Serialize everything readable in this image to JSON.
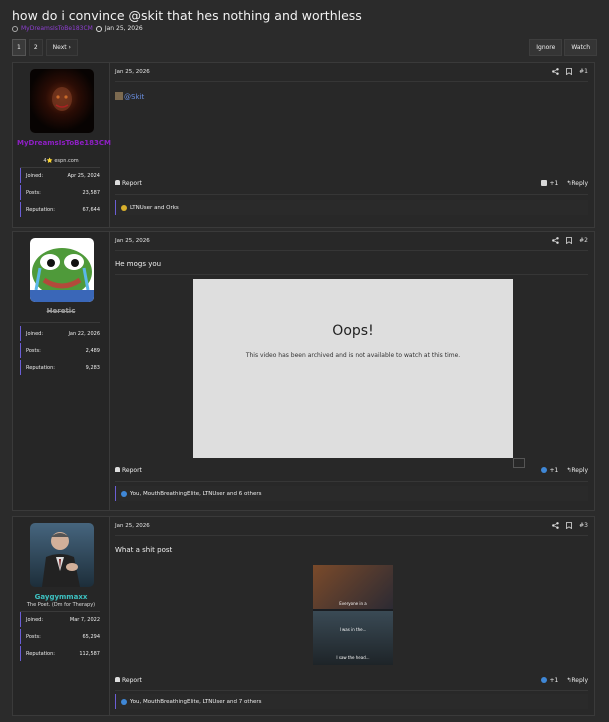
{
  "thread": {
    "title": "how do i convince @skit that hes nothing and worthless",
    "author": "MyDreamsIsToBe183CM",
    "date": "Jan 25, 2026"
  },
  "pager": {
    "pages": [
      "1",
      "2"
    ],
    "next_label": "Next ›"
  },
  "thread_actions": {
    "ignore_label": "Ignore",
    "watch_label": "Watch"
  },
  "posts": [
    {
      "username": "MyDreamsIsToBe183CM",
      "username_color": "#8e1fc4",
      "user_title": "4⭐ espn.com",
      "stats": [
        {
          "label": "Joined:",
          "value": "Apr 25, 2024"
        },
        {
          "label": "Posts:",
          "value": "23,587"
        },
        {
          "label": "Reputation:",
          "value": "67,644"
        }
      ],
      "date": "Jan 25, 2026",
      "number": "#1",
      "body": "@Skit",
      "report_label": "Report",
      "reaction_count": "+1",
      "reply_label": "Reply",
      "reactions": "LTNUser and Orks"
    },
    {
      "username": "Heretic",
      "username_color": "#9b9b9b",
      "user_title": "",
      "stats": [
        {
          "label": "Joined:",
          "value": "Jan 22, 2026"
        },
        {
          "label": "Posts:",
          "value": "2,489"
        },
        {
          "label": "Reputation:",
          "value": "9,283"
        }
      ],
      "date": "Jan 25, 2026",
      "number": "#2",
      "body": "He mogs you",
      "video": {
        "heading": "Oops!",
        "message": "This video has been archived and is not available to watch at this time."
      },
      "report_label": "Report",
      "reaction_count": "+1",
      "reply_label": "Reply",
      "reactions": "You, MouthBreathingElite, LTNUser and 6 others"
    },
    {
      "username": "Gaygymmaxx",
      "username_color": "#3dc1c1",
      "user_title": "The Poet. (Dm for Therapy)",
      "stats": [
        {
          "label": "Joined:",
          "value": "Mar 7, 2022"
        },
        {
          "label": "Posts:",
          "value": "65,294"
        },
        {
          "label": "Reputation:",
          "value": "112,587"
        }
      ],
      "date": "Jan 25, 2026",
      "number": "#3",
      "body": "What a shit post",
      "image_captions": [
        "Everyone in a",
        "I was in the...",
        "I saw the head..."
      ],
      "report_label": "Report",
      "reaction_count": "+1",
      "reply_label": "Reply",
      "reactions": "You, MouthBreathingElite, LTNUser and 7 others"
    }
  ],
  "colors": {
    "accent_line": "#6b5ed6",
    "mention": "#6a8fe0",
    "reaction_blue": "#3f87d6"
  }
}
